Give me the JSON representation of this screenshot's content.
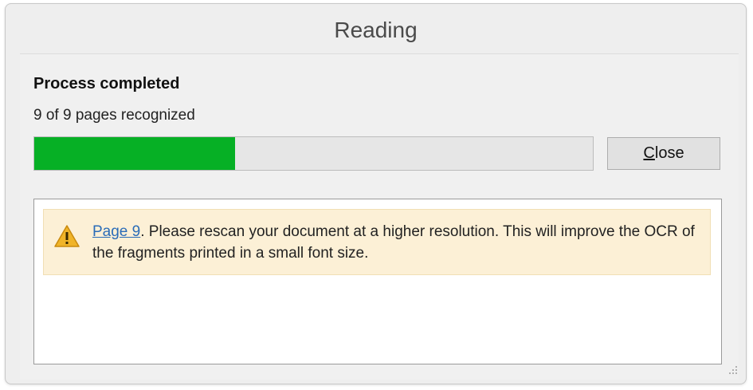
{
  "window": {
    "title": "Reading"
  },
  "status": {
    "heading": "Process completed",
    "pages_text": "9 of 9 pages recognized"
  },
  "progress": {
    "fill_percent": 36,
    "color": "#06b025"
  },
  "buttons": {
    "close_mnemonic": "C",
    "close_rest": "lose"
  },
  "messages": [
    {
      "icon": "warning-icon",
      "link": "Page 9",
      "text": ". Please rescan your document at a higher resolution. This will improve the OCR of the fragments printed in a small font size."
    }
  ]
}
